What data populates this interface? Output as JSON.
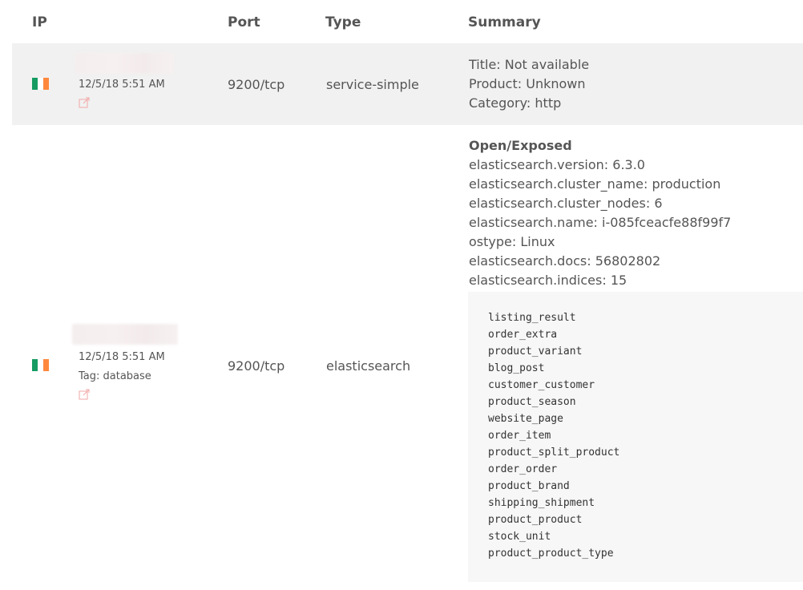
{
  "columns": {
    "ip": "IP",
    "port": "Port",
    "type": "Type",
    "summary": "Summary"
  },
  "results": [
    {
      "country_flag": "ireland-flag",
      "timestamp": "12/5/18 5:51 AM",
      "port": "9200/tcp",
      "type": "service-simple",
      "summary_lines": [
        "Title: Not available",
        "Product: Unknown",
        "Category: http"
      ]
    },
    {
      "country_flag": "ireland-flag",
      "timestamp": "12/5/18 5:51 AM",
      "tag": "Tag: database",
      "port": "9200/tcp",
      "type": "elasticsearch",
      "summary_heading": "Open/Exposed",
      "summary_lines": [
        "elasticsearch.version: 6.3.0",
        "elasticsearch.cluster_name: production",
        "elasticsearch.cluster_nodes: 6",
        "elasticsearch.name: i-085fceacfe88f99f7",
        "ostype: Linux",
        "elasticsearch.docs: 56802802",
        "elasticsearch.indices: 15"
      ],
      "indices": [
        "listing_result",
        "order_extra",
        "product_variant",
        "blog_post",
        "customer_customer",
        "product_season",
        "website_page",
        "order_item",
        "product_split_product",
        "order_order",
        "product_brand",
        "shipping_shipment",
        "product_product",
        "stock_unit",
        "product_product_type"
      ]
    }
  ],
  "colors": {
    "row_alt_bg": "#f1f1f1",
    "text": "#555555",
    "history_icon": "#f2a7a7",
    "code_bg": "#f7f7f7"
  }
}
